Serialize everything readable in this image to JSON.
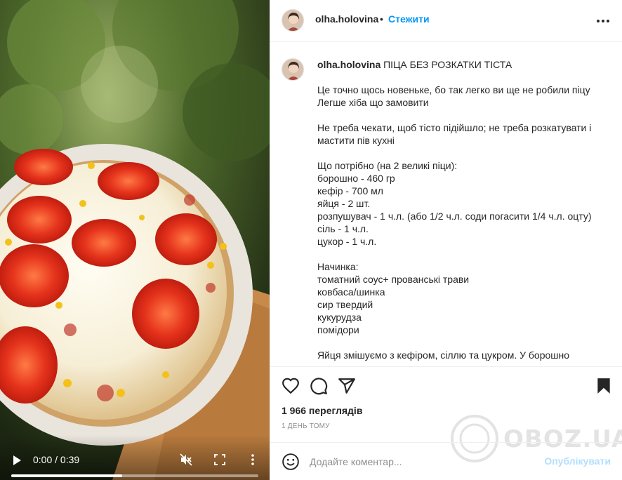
{
  "video": {
    "time": "0:00 / 0:39",
    "progress": 0.45,
    "play_icon": "play-icon",
    "mute_icon": "volume-muted-icon",
    "fullscreen_icon": "fullscreen-icon",
    "more_icon": "more-vertical-icon"
  },
  "header": {
    "username": "olha.holovina",
    "separator": "•",
    "follow_label": "Стежити",
    "more_icon": "more-horizontal-icon"
  },
  "caption": {
    "username": "olha.holovina",
    "title": " ПІЦА БЕЗ РОЗКАТКИ ТІСТА",
    "lines": [
      "Це точно щось новеньке, бо так легко ви ще не робили піцу",
      "Легше хіба що замовити",
      "",
      "Не треба чекати, щоб тісто підійшло; не треба розкатувати і",
      "мастити пів кухні",
      "",
      "Що потрібно (на 2 великі піци):",
      "борошно - 460 гр",
      "кефір - 700 мл",
      "яйця - 2 шт.",
      "розпушувач - 1 ч.л. (або 1/2 ч.л. соди погасити 1/4 ч.л. оцту)",
      "сіль - 1 ч.л.",
      "цукор - 1 ч.л.",
      "",
      "Начинка:",
      "томатний соус+ прованські трави",
      "ковбаса/шинка",
      "сир твердий",
      "кукурудза",
      "помідори",
      "",
      "Яйця змішуємо з кефіром, сіллю та цукром. У борошно"
    ]
  },
  "actions": {
    "like_icon": "heart-icon",
    "comment_icon": "comment-icon",
    "share_icon": "share-icon",
    "save_icon": "bookmark-icon"
  },
  "stats": {
    "views": "1 966 переглядів",
    "posted": "1 ДЕНЬ ТОМУ"
  },
  "comment": {
    "emoji_icon": "emoji-icon",
    "placeholder": "Додайте коментар...",
    "publish_label": "Опублікувати"
  },
  "watermark": {
    "text": "OBOZ.UA"
  },
  "colors": {
    "accent": "#0095f6",
    "publish_disabled": "#b2dffc",
    "text": "#262626",
    "muted": "#8e8e8e",
    "border": "#efefef"
  }
}
